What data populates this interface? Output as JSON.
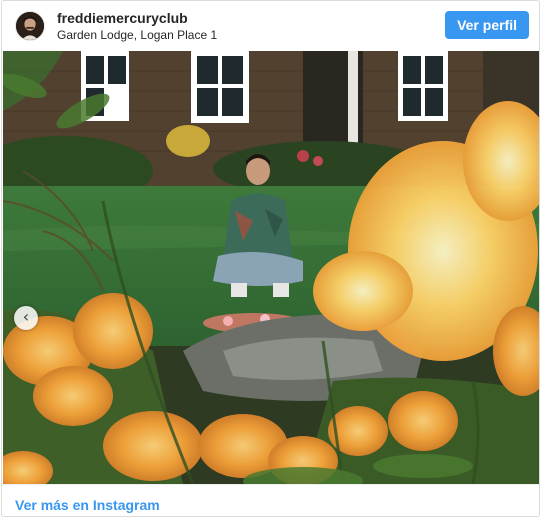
{
  "post": {
    "username": "freddiemercuryclub",
    "location": "Garden Lodge, Logan Place 1",
    "view_profile_label": "Ver perfil",
    "view_more_label": "Ver más en Instagram",
    "prev_arrow": "‹"
  },
  "colors": {
    "accent": "#3897f0",
    "text": "#262626",
    "border": "#dbdbdb"
  },
  "icons": {
    "avatar": "profile-photo",
    "prev": "chevron-left-icon"
  }
}
